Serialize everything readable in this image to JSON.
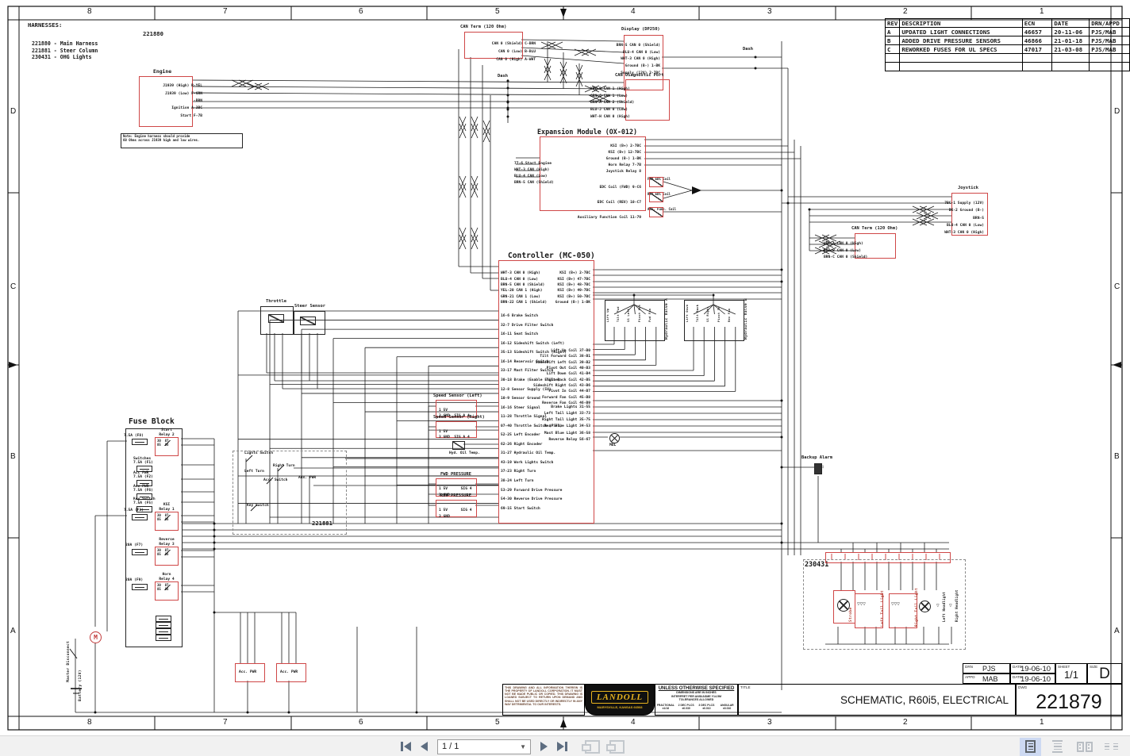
{
  "sheet": {
    "zones": {
      "top": [
        "8",
        "7",
        "6",
        "5",
        "4",
        "3",
        "2",
        "1"
      ],
      "bottom": [
        "8",
        "7",
        "6",
        "5",
        "4",
        "3",
        "2",
        "1"
      ],
      "left": [
        "D",
        "C",
        "B",
        "A"
      ],
      "right": [
        "D",
        "C",
        "B",
        "A"
      ]
    },
    "harness": {
      "title": "HARNESSES:",
      "items": [
        "221880 - Main Harness",
        "221881 - Steer Column",
        "230431 - OHG Lights"
      ],
      "main_ref": "221880"
    },
    "rev": {
      "headers": {
        "rev": "REV",
        "desc": "DESCRIPTION",
        "ecn": "ECN",
        "date": "DATE",
        "by": "DRN/APPD"
      },
      "rows": [
        {
          "rev": "A",
          "desc": "UPDATED LIGHT CONNECTIONS",
          "ecn": "46657",
          "date": "20-11-06",
          "by": "PJS/MAB"
        },
        {
          "rev": "B",
          "desc": "ADDED DRIVE PRESSURE SENSORS",
          "ecn": "46866",
          "date": "21-01-18",
          "by": "PJS/MAB"
        },
        {
          "rev": "C",
          "desc": "REWORKED FUSES FOR UL SPECS",
          "ecn": "47017",
          "date": "21-03-08",
          "by": "PJS/MAB"
        }
      ]
    },
    "comp": {
      "engine": {
        "title": "Engine",
        "pins": [
          "J1939 (High) R-YEL",
          "J1939 (Low) F-GRN",
          "-BRN",
          "Ignition A-3BC",
          "Start F-7B"
        ],
        "note": "Note: Engine harness should provide\n60 Ohms across J1939 high and low wires."
      },
      "can_term_top": {
        "title": "CAN Term (120 Ohm)",
        "pins": [
          "CAN 0 (Shield) C-BRN",
          "CAN 0 (Low) B-BLU",
          "CAN 0 (High) A-WHT"
        ]
      },
      "display": {
        "title": "Display (DP250)",
        "pins": [
          "BRN-5 CAN 0 (Shield)",
          "BLU-4 CAN 0 (Low)",
          "WHT-3 CAN 0 (High)",
          "Ground (B-) 1-BK",
          "Supply (12V) 2-7BC"
        ]
      },
      "dash1": "Dash",
      "dash2": "Dash",
      "can_diag": {
        "title": "CAN Diagnostic Port",
        "pins": [
          "YEL-D CAN 1 (High)",
          "GRN-C CAN 1 (Low)",
          "BRN-A CAN 2 (Shield)",
          "BLU-J CAN 0 (Low)",
          "WHT-H CAN 0 (High)"
        ]
      },
      "expansion": {
        "title": "Expansion Module (OX-012)",
        "left": [
          "77-6 Start Engine",
          "WHT-3 CAN (High)",
          "BLU-4 CAN (Low)",
          "BRN-5 CAN (Shield)"
        ],
        "right": [
          "KSI (B+) 2-7BC",
          "KSI (B+) 12-7BC",
          "Ground (B-) 1-BK",
          "Horn Relay 7-7B",
          "Joystick Relay 8"
        ],
        "edc": [
          "EDC Coil (FWD) 9-C6",
          "EDC Coil (REV) 10-C7",
          "Auxiliary Function Coil 11-79"
        ],
        "coils": [
          "FWD EDC Coil",
          "REV EDC Coil",
          "Aux. Func. Coil"
        ]
      },
      "controller": {
        "title": "Controller (MC-050)",
        "left_can": [
          "WHT-3 CAN 0 (High)",
          "BLU-4 CAN 0 (Low)",
          "BRN-5 CAN 0 (Shield)",
          "YEL-20 CAN 1 (High)",
          "GRN-21 CAN 1 (Low)",
          "BRN-22 CAN 1 (Shield)"
        ],
        "left_sw": [
          "16-6 Brake Switch",
          "32-7 Drive Filter Switch",
          "16-11 Seat Switch",
          "16-12 Sideshift Switch (Left)",
          "35-13 Sideshift Switch (Right)",
          "16-14 Reservoir Switch",
          "33-17 Mast Filter Switch",
          "30-18 Brake (Enable Engine)",
          "12-8 Sensor Supply (5V)",
          "10-9 Sensor Ground",
          "16-16 Steer Signal",
          "11-28 Throttle Signal",
          "07-40 Throttle Switch (FS-1)",
          "52-25 Left Encoder",
          "62-26 Right Encoder",
          "31-27 Hydraulic Oil Temp.",
          "43-19 Work Lights Switch",
          "37-23 Right Turn",
          "38-24 Left Turn",
          "53-29 Forward Drive Pressure",
          "54-30 Reverse Drive Pressure",
          "69-15 Start Switch"
        ],
        "right_top": [
          "KSI (B+) 2-7BC",
          "KSI (B+) 47-7BC",
          "KSI (B+) 48-7BC",
          "KSI (B+) 49-7BC",
          "KSI (B+) 50-7BC",
          "Ground (B-) 1-BK"
        ],
        "right_coils": [
          "Lift Up Coil 37-B0",
          "Tilt Forward Coil 38-B1",
          "Sideshift Left Coil 39-B2",
          "Pivot Out Coil 40-B3",
          "Lift Down Coil 41-B4",
          "Tilt Back Coil 42-B5",
          "Sideshift Right Coil 43-B6",
          "Pivot In Coil 44-B7",
          "Forward Fan Coil 45-B8",
          "Reverse Fan Coil 46-B9"
        ],
        "right_lights": [
          "Brake Lights 31-55",
          "Left Tail Light 33-73",
          "Right Tail Light 35-75",
          "Rear Blue Light 34-53",
          "Mast Blue Light 36-58",
          "Reverse Relay 56-67"
        ]
      },
      "joystick": {
        "title": "Joystick",
        "pins": [
          "7BC-1 Supply (12V)",
          "BK-2 Ground (B-)",
          "BRN-5",
          "BLU-4 CAN 0 (Low)",
          "WHT-3 CAN 0 (High)"
        ]
      },
      "can_term_right": {
        "title": "CAN Term (120 Ohm)",
        "pins": [
          "WHT-A CAN 0 (High)",
          "BLU-B CAN 0 (Low)",
          "BRN-C CAN 0 (Shield)"
        ]
      },
      "fuse": {
        "title": "Fuse Block",
        "relay_pins": "30  87\n85  86",
        "relays": [
          {
            "name": "Start\nRelay 2",
            "fuse": "7.5A (F8)"
          },
          {
            "name": "KSI\nRelay 1",
            "fuse": "7.5A (F3)"
          },
          {
            "name": "Reverse\nRelay 3",
            "fuse": "20A (F7)"
          },
          {
            "name": "Horn\nRelay 4",
            "fuse": "20A (F9)"
          }
        ],
        "fuses": [
          {
            "name": "Switches",
            "rating": "7.5A (F1)"
          },
          {
            "name": "Acc PWR",
            "rating": "7.5A (F2)"
          },
          {
            "name": "Acc PWR",
            "rating": "7.5A (F6)"
          },
          {
            "name": "Key Switch",
            "rating": "7.5A (F5)"
          }
        ]
      },
      "throttle": "Throttle",
      "steer": "Steer Sensor",
      "speedL": {
        "title": "Speed Sensor (Left)",
        "pins": [
          "1 5V",
          "3 GND  SIG A 4"
        ]
      },
      "speedR": {
        "title": "Speed Sensor (Right)",
        "pins": [
          "1 5V",
          "3 GND  SIG A 4"
        ]
      },
      "fwdp": {
        "title": "FWD PRESSURE",
        "pins": [
          "1 5V      SIG 4",
          "3 GND"
        ]
      },
      "revp": {
        "title": "REV PRESSURE",
        "pins": [
          "1 5V      SIG 4",
          "3 GND"
        ]
      },
      "hydtemp": "Hyd. Oil Temp.",
      "mol": "MOL",
      "backup": "Backup Alarm",
      "valves": {
        "a": {
          "title": "Hydraulic Valve A",
          "coils": [
            "Lift Up",
            "Tilt Fwd",
            "SS Left",
            "Pivot Out",
            "Fwd Fan"
          ]
        },
        "b": {
          "title": "Hydraulic Valve B",
          "coils": [
            "Lift Down",
            "Tilt Back",
            "SS Right",
            "Pivot In",
            "Rev Fan"
          ]
        }
      },
      "steercol": {
        "ref": "221881",
        "lights": "Lights Switch",
        "rturn": "Right Turn",
        "lturn": "Left Turn",
        "accsw": "Acc. Switch",
        "auxpwr": "Aux. PWR",
        "keysw": "Key Switch"
      },
      "accpwr1": "Acc. PWR",
      "accpwr2": "Acc. PWR",
      "power": {
        "master": "Master Disconnect",
        "battery": "Battery (12V)",
        "motor": "M"
      },
      "ohg": {
        "ref": "230431",
        "strobe": "Strobe",
        "ltl": "Left Tail Light",
        "rtl": "Right Tail Light",
        "lhl": "Left Headlight",
        "rhl": "Right Headlight"
      }
    },
    "titleblock": {
      "disclaimer": "THIS DRAWING AND ALL INFORMATION THEREIN IS THE PROPERTY OF LANDOLL CORPORATION. IT MUST NOT BE MADE PUBLIC OR COPIED. THIS DRAWING IS LOANED SUBJECT TO RETURN UPON DEMAND AND SHALL NOT BE USED DIRECTLY OR INDIRECTLY IN ANY WAY DETRIMENTAL TO OUR INTERESTS.",
      "logo_name": "LANDOLL",
      "logo_city": "MARYSVILLE, KANSAS 66508",
      "spec_head": "UNLESS OTHERWISE SPECIFIED",
      "spec_lines": [
        "DIMENSIONS ARE IN INCHES",
        "INTERPRET PER ANSI/ASME Y14.5M",
        "TOLERANCES ALLOWED"
      ],
      "spec_cols": [
        "FRACTIONAL ±1/16",
        "2 DEC PLCS ±0.030",
        "3 DEC PLCS ±0.010",
        "ANGULAR ±0.010"
      ],
      "title_label": "TITLE",
      "title": "SCHEMATIC, R60i5, ELECTRICAL",
      "dwg_label": "DWG",
      "dwg": "221879",
      "drn_label": "DRN",
      "drn": "PJS",
      "appd_label": "APPD",
      "appd": "MAB",
      "date_label": "DATE",
      "date1": "19-06-10",
      "date2": "19-06-10",
      "sheet_label": "SHEET",
      "sheet": "1/1",
      "size_label": "SIZE",
      "size": "D"
    }
  },
  "toolbar": {
    "page_display": "1 / 1"
  }
}
